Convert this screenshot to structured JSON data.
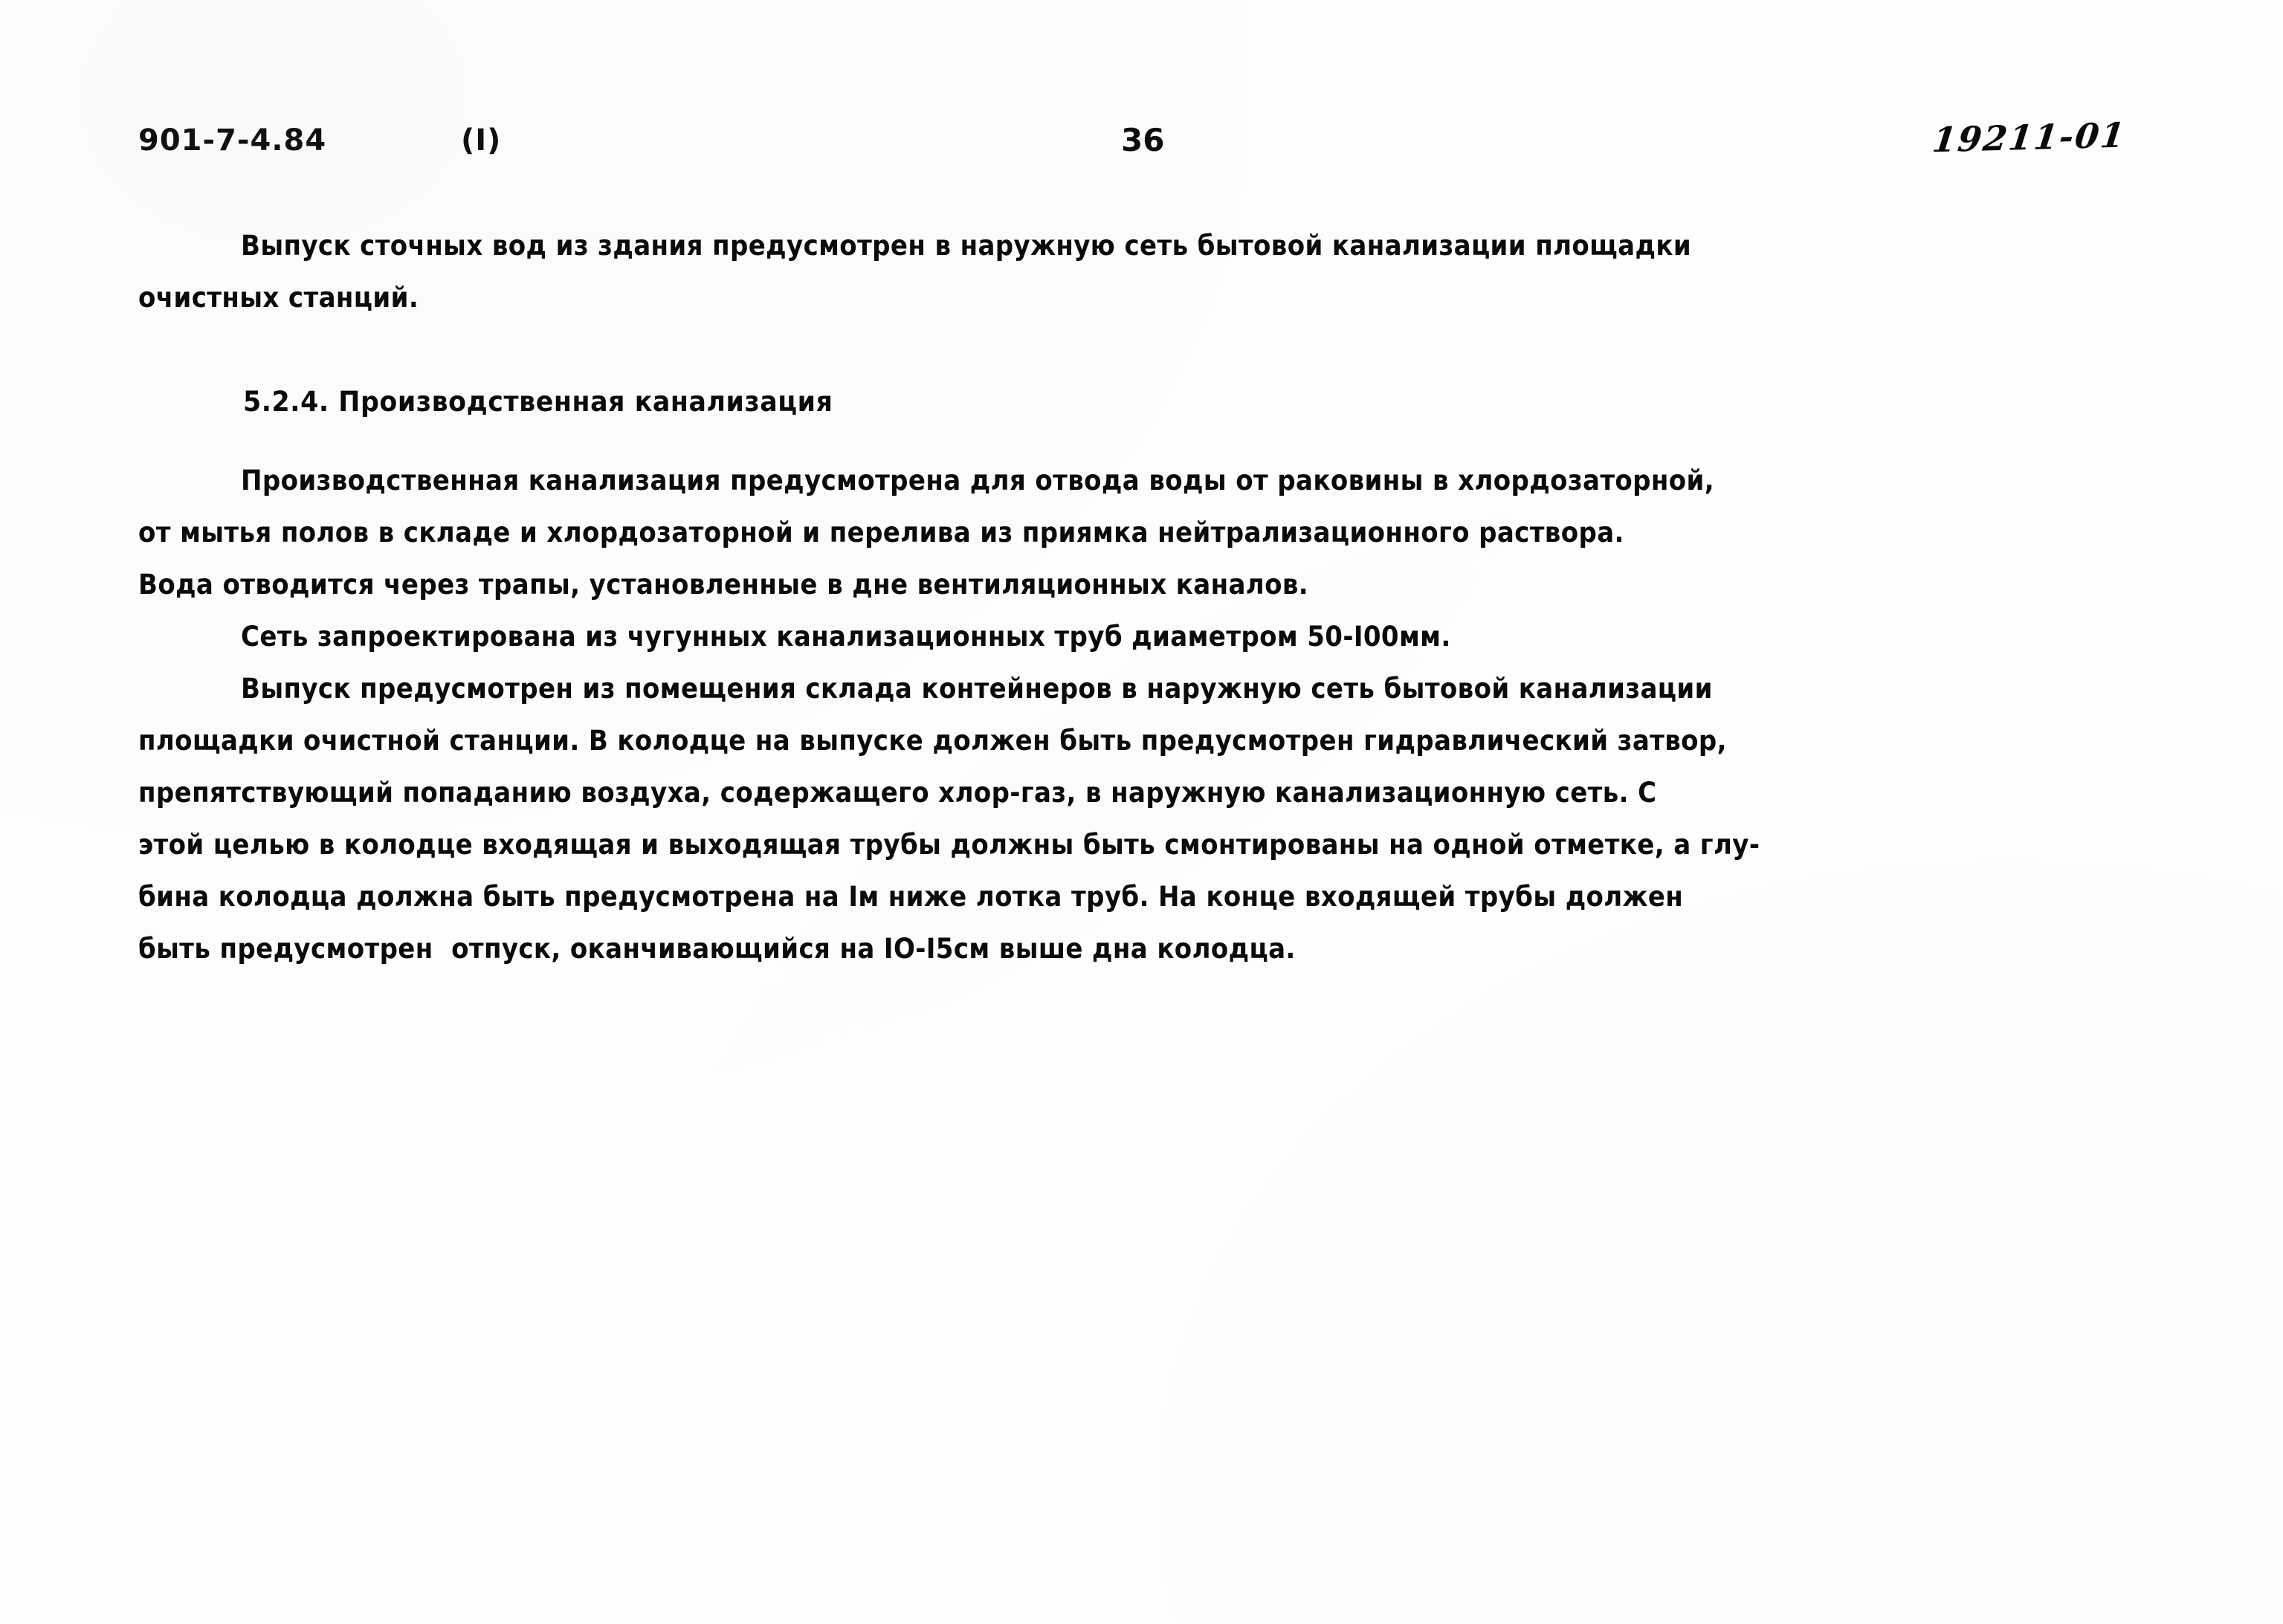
{
  "header": {
    "doc_code": "901-7-4.84",
    "doc_part": "(I)",
    "page_number": "36",
    "hand_annotation": "19211-01"
  },
  "body": {
    "paragraph_1": {
      "lines": [
        "Выпуск сточных вод из здания предусмотрен в наружную сеть бытовой канализации площадки",
        "очистных станций."
      ]
    },
    "heading_524": "5.2.4. Производственная канализация",
    "paragraph_2": {
      "lines": [
        "Производственная канализация предусмотрена для отвода воды от раковины в хлордозаторной,",
        "от мытья полов в складе и хлордозаторной и перелива из приямка нейтрализационного раствора.",
        "Вода отводится через трапы, установленные в дне вентиляционных каналов."
      ]
    },
    "paragraph_3": {
      "lines": [
        "Сеть запроектирована из чугунных канализационных труб диаметром 50-I00мм."
      ]
    },
    "paragraph_4": {
      "lines": [
        "Выпуск предусмотрен из помещения склада контейнеров в наружную сеть бытовой канализации",
        "площадки очистной станции. В колодце на выпуске должен быть предусмотрен гидравлический затвор,",
        "препятствующий попаданию воздуха, содержащего хлор-газ, в наружную канализационную сеть. С",
        "этой целью в колодце входящая и выходящая трубы должны быть смонтированы на одной отметке, а глу-",
        "бина колодца должна быть предусмотрена на Iм ниже лотка труб. На конце входящей трубы должен",
        "быть предусмотрен  отпуск, оканчивающийся на IО-I5см выше дна колодца."
      ]
    }
  },
  "colors": {
    "page_background": "#fefefe",
    "text": "#0b0b0b"
  }
}
